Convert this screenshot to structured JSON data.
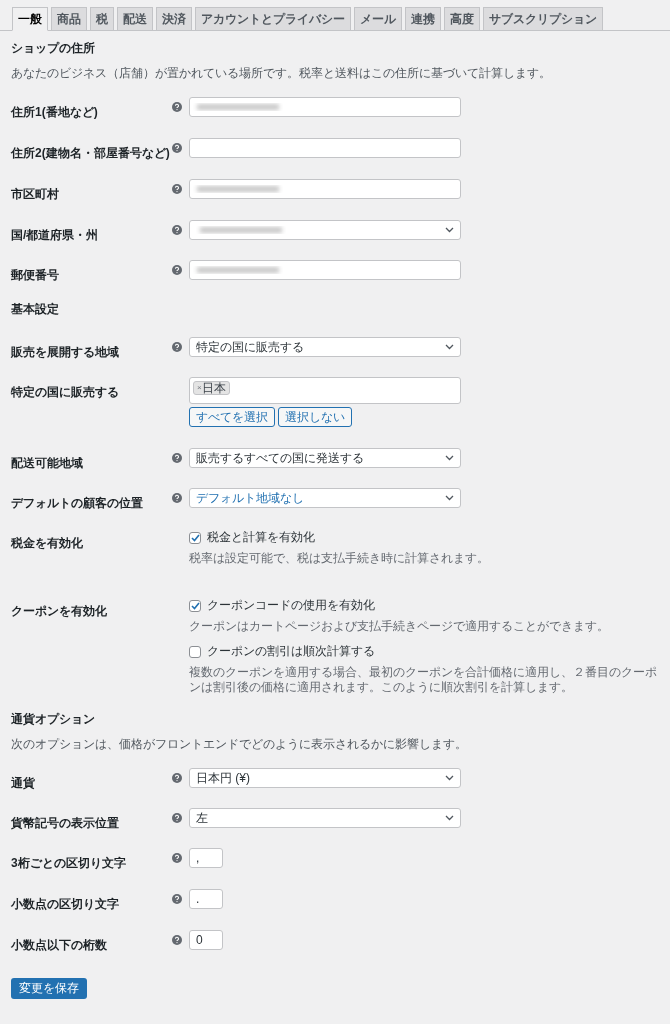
{
  "tabs": [
    {
      "label": "一般",
      "selected": true
    },
    {
      "label": "商品",
      "selected": false
    },
    {
      "label": "税",
      "selected": false
    },
    {
      "label": "配送",
      "selected": false
    },
    {
      "label": "決済",
      "selected": false
    },
    {
      "label": "アカウントとプライバシー",
      "selected": false
    },
    {
      "label": "メール",
      "selected": false
    },
    {
      "label": "連携",
      "selected": false
    },
    {
      "label": "高度",
      "selected": false
    },
    {
      "label": "サブスクリプション",
      "selected": false
    }
  ],
  "sections": [
    {
      "title": "ショップの住所",
      "description": "あなたのビジネス（店舗）が置かれている場所です。税率と送料はこの住所に基づいて計算します。",
      "fields": [
        {
          "kind": "text",
          "label": "住所1(番地など)",
          "help": true,
          "redacted": true
        },
        {
          "kind": "text",
          "label": "住所2(建物名・部屋番号など)",
          "help": true,
          "redacted": false
        },
        {
          "kind": "text",
          "label": "市区町村",
          "help": true,
          "redacted": true
        },
        {
          "kind": "select",
          "label": "国/都道府県・州",
          "help": true,
          "redacted": true
        },
        {
          "kind": "text",
          "label": "郵便番号",
          "help": true,
          "redacted": true
        }
      ]
    },
    {
      "title": "基本設定",
      "fields": [
        {
          "kind": "select",
          "label": "販売を展開する地域",
          "help": true,
          "value": "特定の国に販売する"
        },
        {
          "kind": "multiselect",
          "label": "特定の国に販売する",
          "help": false,
          "tags": [
            {
              "remove": "×",
              "label": "日本"
            }
          ],
          "buttons": [
            "すべてを選択",
            "選択しない"
          ]
        },
        {
          "kind": "select",
          "label": "配送可能地域",
          "help": true,
          "value": "販売するすべての国に発送する"
        },
        {
          "kind": "select",
          "label": "デフォルトの顧客の位置",
          "help": true,
          "value": "デフォルト地域なし",
          "link": true
        },
        {
          "kind": "checkboxes",
          "label": "税金を有効化",
          "help": false,
          "options": [
            {
              "label": "税金と計算を有効化",
              "checked": true,
              "description": "税率は設定可能で、税は支払手続き時に計算されます。"
            }
          ]
        },
        {
          "kind": "checkboxes",
          "label": "クーポンを有効化",
          "help": false,
          "options": [
            {
              "label": "クーポンコードの使用を有効化",
              "checked": true,
              "description": "クーポンはカートページおよび支払手続きページで適用することができます。"
            },
            {
              "label": "クーポンの割引は順次計算する",
              "checked": false,
              "description": "複数のクーポンを適用する場合、最初のクーポンを合計価格に適用し、２番目のクーポンは割引後の価格に適用されます。このように順次割引を計算します。"
            }
          ]
        }
      ]
    },
    {
      "title": "通貨オプション",
      "description": "次のオプションは、価格がフロントエンドでどのように表示されるかに影響します。",
      "fields": [
        {
          "kind": "select",
          "label": "通貨",
          "help": true,
          "value": "日本円 (¥)"
        },
        {
          "kind": "select",
          "label": "貨幣記号の表示位置",
          "help": true,
          "value": "左"
        },
        {
          "kind": "short",
          "label": "3桁ごとの区切り文字",
          "help": true,
          "value": ","
        },
        {
          "kind": "short",
          "label": "小数点の区切り文字",
          "help": true,
          "value": "."
        },
        {
          "kind": "short",
          "label": "小数点以下の桁数",
          "help": true,
          "value": "0"
        }
      ]
    }
  ],
  "save_button": "変更を保存"
}
